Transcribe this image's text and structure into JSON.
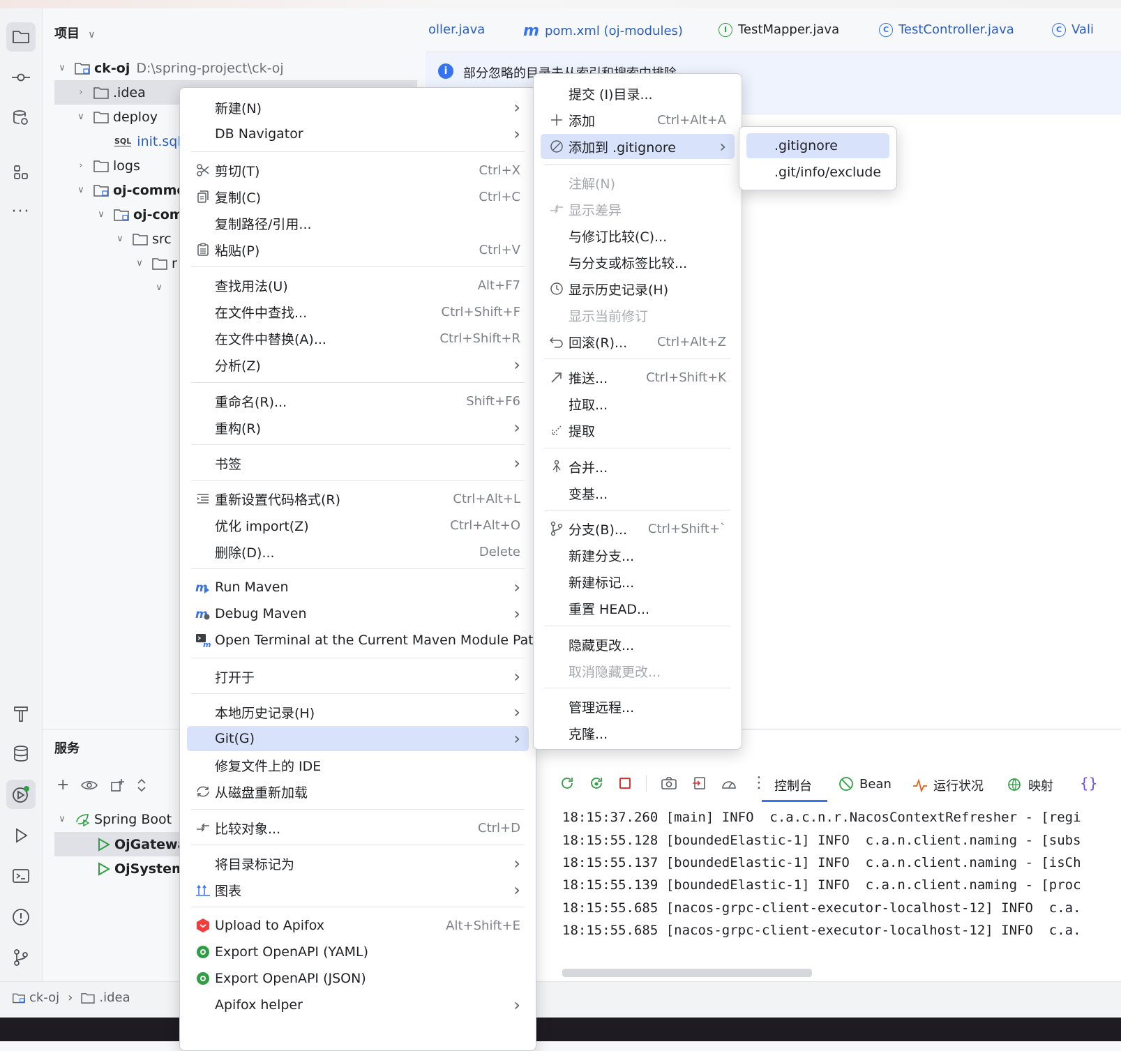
{
  "project_panel": {
    "title": "项目",
    "tree": [
      {
        "label": "ck-oj",
        "path": "D:\\spring-project\\ck-oj"
      },
      {
        "label": ".idea"
      },
      {
        "label": "deploy"
      },
      {
        "label": "init.sql"
      },
      {
        "label": "logs"
      },
      {
        "label": "oj-commo"
      },
      {
        "label": "oj-com"
      },
      {
        "label": "src"
      },
      {
        "label": "r"
      }
    ]
  },
  "tabs": [
    {
      "label": "oller.java",
      "icon": "java-class-icon"
    },
    {
      "label": "pom.xml (oj-modules)",
      "icon": "maven-icon"
    },
    {
      "label": "TestMapper.java",
      "icon": "interface-icon"
    },
    {
      "label": "TestController.java",
      "icon": "class-icon"
    },
    {
      "label": "Vali",
      "icon": "class-icon"
    }
  ],
  "infobar": {
    "text": "部分忽略的目录未从索引和搜索中排除"
  },
  "context_menu": {
    "items": [
      {
        "label": "新建(N)",
        "arrow": true
      },
      {
        "label": "DB Navigator",
        "arrow": true
      },
      {
        "label": "剪切(T)",
        "shortcut": "Ctrl+X",
        "icon": "scissors-icon"
      },
      {
        "label": "复制(C)",
        "shortcut": "Ctrl+C",
        "icon": "copy-icon"
      },
      {
        "label": "复制路径/引用..."
      },
      {
        "label": "粘贴(P)",
        "shortcut": "Ctrl+V",
        "icon": "paste-icon"
      },
      {
        "label": "查找用法(U)",
        "shortcut": "Alt+F7"
      },
      {
        "label": "在文件中查找...",
        "shortcut": "Ctrl+Shift+F"
      },
      {
        "label": "在文件中替换(A)...",
        "shortcut": "Ctrl+Shift+R"
      },
      {
        "label": "分析(Z)",
        "arrow": true
      },
      {
        "label": "重命名(R)...",
        "shortcut": "Shift+F6"
      },
      {
        "label": "重构(R)",
        "arrow": true
      },
      {
        "label": "书签",
        "arrow": true
      },
      {
        "label": "重新设置代码格式(R)",
        "shortcut": "Ctrl+Alt+L",
        "icon": "format-icon"
      },
      {
        "label": "优化 import(Z)",
        "shortcut": "Ctrl+Alt+O"
      },
      {
        "label": "删除(D)...",
        "shortcut": "Delete"
      },
      {
        "label": "Run Maven",
        "arrow": true,
        "icon": "maven-run-icon"
      },
      {
        "label": "Debug Maven",
        "arrow": true,
        "icon": "maven-debug-icon"
      },
      {
        "label": "Open Terminal at the Current Maven Module Path",
        "icon": "maven-terminal-icon"
      },
      {
        "label": "打开于",
        "arrow": true
      },
      {
        "label": "本地历史记录(H)",
        "arrow": true
      },
      {
        "label": "Git(G)",
        "arrow": true,
        "selected": true
      },
      {
        "label": "修复文件上的 IDE"
      },
      {
        "label": "从磁盘重新加载",
        "icon": "reload-icon"
      },
      {
        "label": "比较对象...",
        "shortcut": "Ctrl+D",
        "icon": "compare-icon"
      },
      {
        "label": "将目录标记为",
        "arrow": true
      },
      {
        "label": "图表",
        "arrow": true,
        "icon": "diagram-icon"
      },
      {
        "label": "Upload to Apifox",
        "shortcut": "Alt+Shift+E",
        "icon": "apifox-icon"
      },
      {
        "label": "Export OpenAPI (YAML)",
        "icon": "openapi-icon"
      },
      {
        "label": "Export OpenAPI (JSON)",
        "icon": "openapi-icon"
      },
      {
        "label": "Apifox helper",
        "arrow": true
      }
    ]
  },
  "git_menu": {
    "items": [
      {
        "label": "提交 (I)目录..."
      },
      {
        "label": "添加",
        "shortcut": "Ctrl+Alt+A",
        "icon": "plus-icon"
      },
      {
        "label": "添加到 .gitignore",
        "arrow": true,
        "selected": true,
        "icon": "ignore-icon"
      },
      {
        "label": "注解(N)",
        "disabled": true
      },
      {
        "label": "显示差异",
        "disabled": true,
        "icon": "diff-icon"
      },
      {
        "label": "与修订比较(C)..."
      },
      {
        "label": "与分支或标签比较..."
      },
      {
        "label": "显示历史记录(H)",
        "icon": "history-icon"
      },
      {
        "label": "显示当前修订",
        "disabled": true
      },
      {
        "label": "回滚(R)...",
        "shortcut": "Ctrl+Alt+Z",
        "icon": "rollback-icon"
      },
      {
        "label": "推送...",
        "shortcut": "Ctrl+Shift+K",
        "icon": "push-icon"
      },
      {
        "label": "拉取..."
      },
      {
        "label": "提取",
        "icon": "fetch-icon"
      },
      {
        "label": "合并...",
        "icon": "merge-icon"
      },
      {
        "label": "变基..."
      },
      {
        "label": "分支(B)...",
        "shortcut": "Ctrl+Shift+`",
        "icon": "branch-icon"
      },
      {
        "label": "新建分支..."
      },
      {
        "label": "新建标记..."
      },
      {
        "label": "重置 HEAD..."
      },
      {
        "label": "隐藏更改..."
      },
      {
        "label": "取消隐藏更改...",
        "disabled": true
      },
      {
        "label": "管理远程..."
      },
      {
        "label": "克隆..."
      }
    ]
  },
  "gitignore_menu": {
    "items": [
      {
        "label": ".gitignore",
        "selected": true
      },
      {
        "label": ".git/info/exclude"
      }
    ]
  },
  "services": {
    "title": "服务",
    "tree": [
      {
        "label": "Spring Boot"
      },
      {
        "label": "OjGateway"
      },
      {
        "label": "OjSystemA"
      }
    ],
    "console_tabs": [
      "控制台",
      "Bean",
      "运行状况",
      "映射"
    ],
    "log_lines": [
      "18:15:37.260 [main] INFO  c.a.c.n.r.NacosContextRefresher - [regi",
      "18:15:55.128 [boundedElastic-1] INFO  c.a.n.client.naming - [subs",
      "18:15:55.137 [boundedElastic-1] INFO  c.a.n.client.naming - [isCh",
      "18:15:55.139 [boundedElastic-1] INFO  c.a.n.client.naming - [proc",
      "18:15:55.685 [nacos-grpc-client-executor-localhost-12] INFO  c.a.",
      "18:15:55.685 [nacos-grpc-client-executor-localhost-12] INFO  c.a."
    ]
  },
  "breadcrumb": {
    "items": [
      "ck-oj",
      ".idea"
    ]
  },
  "colors": {
    "accent": "#3574f0",
    "selection": "#d8e3fb",
    "run_green": "#2f9e44"
  }
}
